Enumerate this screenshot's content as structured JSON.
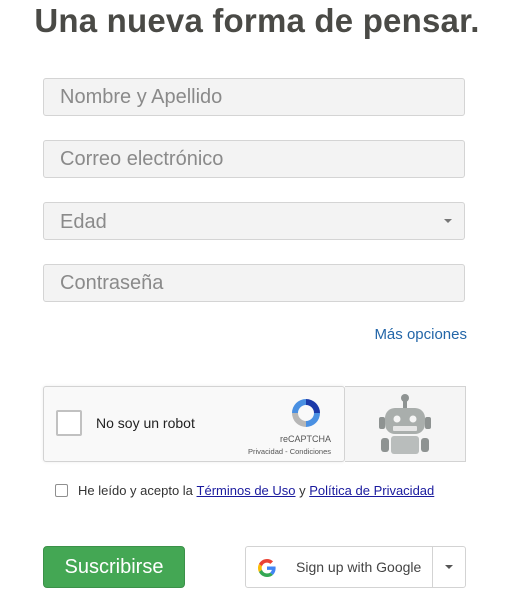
{
  "title": "Una nueva forma de pensar.",
  "form": {
    "name_placeholder": "Nombre y Apellido",
    "email_placeholder": "Correo electrónico",
    "age_select_label": "Edad",
    "password_placeholder": "Contraseña",
    "more_options": "Más opciones"
  },
  "captcha": {
    "label": "No soy un robot",
    "brand": "reCAPTCHA",
    "privacy": "Privacidad",
    "separator": " - ",
    "terms": "Condiciones"
  },
  "terms": {
    "prefix": "He leído y acepto la ",
    "terms_link": "Términos de Uso",
    "joiner": " y ",
    "privacy_link": "Política de Privacidad"
  },
  "buttons": {
    "subscribe": "Suscribirse",
    "google": "Sign up with Google"
  },
  "colors": {
    "subscribe_bg": "#44a754",
    "link": "#2366a8",
    "title": "#4a4a46"
  }
}
